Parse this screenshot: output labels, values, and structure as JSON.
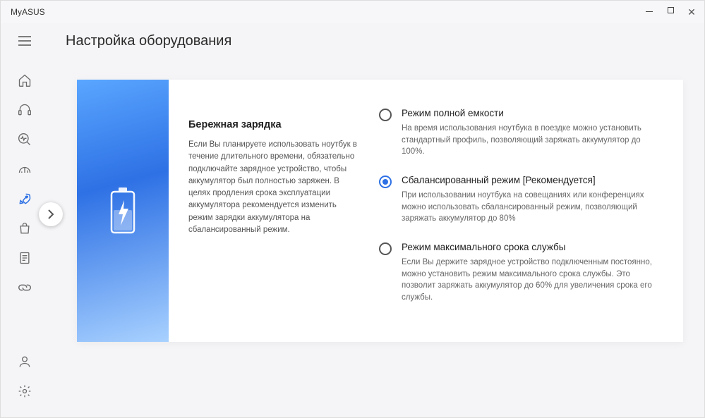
{
  "app": {
    "title": "MyASUS"
  },
  "page_title": "Настройка оборудования",
  "section": {
    "heading": "Бережная зарядка",
    "description": "Если Вы планируете использовать ноутбук в течение длительного времени, обязательно подключайте зарядное устройство, чтобы аккумулятор был полностью заряжен. В целях продления срока эксплуатации аккумулятора рекомендуется изменить режим зарядки аккумулятора на сбалансированный режим."
  },
  "options": [
    {
      "id": "full",
      "title": "Режим полной емкости",
      "desc": "На время использования ноутбука в поездке можно установить стандартный профиль, позволяющий заряжать аккумулятор до 100%.",
      "selected": false
    },
    {
      "id": "balanced",
      "title": "Сбалансированный режим [Рекомендуется]",
      "desc": "При использовании ноутбука на совещаниях или конференциях можно использовать сбалансированный режим, позволяющий заряжать аккумулятор до 80%",
      "selected": true
    },
    {
      "id": "maxlife",
      "title": "Режим максимального срока службы",
      "desc": "Если Вы держите зарядное устройство подключенным постоянно, можно установить режим максимального срока службы. Это позволит заряжать аккумулятор до 60% для увеличения срока его службы.",
      "selected": false
    }
  ],
  "sidebar": {
    "items": [
      "home",
      "support",
      "diagnosis",
      "performance",
      "rocket",
      "store",
      "document",
      "link"
    ],
    "bottom": [
      "profile",
      "settings"
    ],
    "active": "rocket"
  }
}
